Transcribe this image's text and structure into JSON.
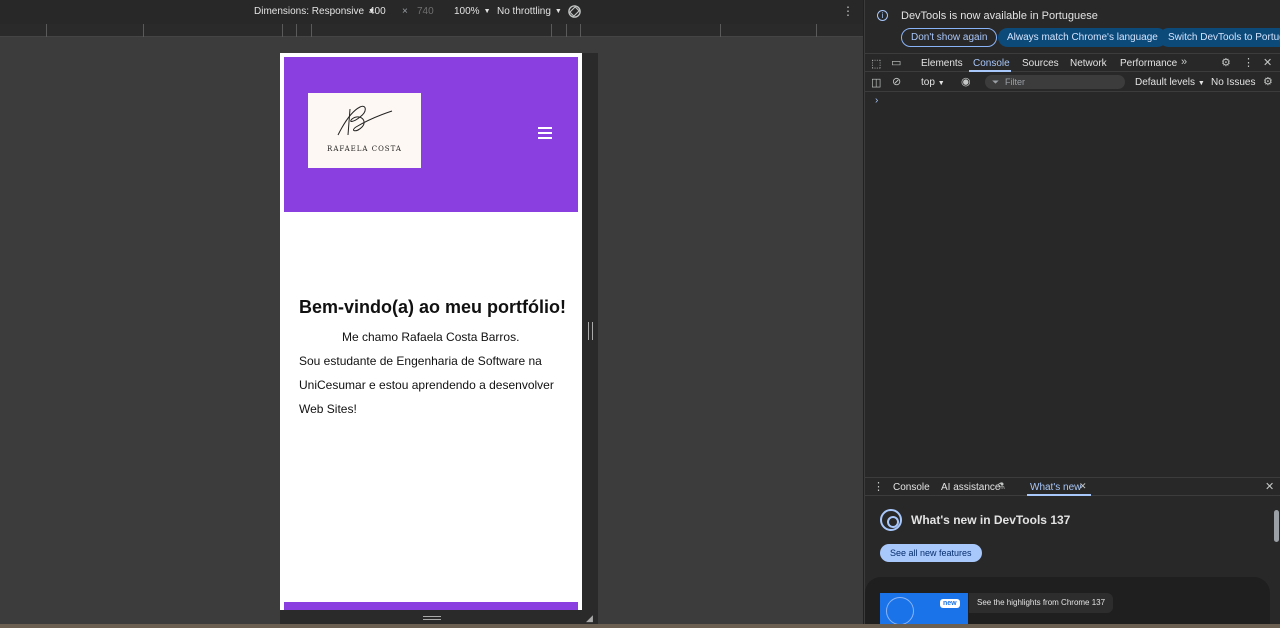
{
  "device_toolbar": {
    "dimensions_label": "Dimensions: Responsive",
    "width": "400",
    "times": "×",
    "height": "740",
    "zoom": "100%",
    "throttling": "No throttling"
  },
  "page": {
    "logo_text": "RAFAELA COSTA",
    "heading": "Bem-vindo(a) ao meu portfólio!",
    "paragraph_line1": "Me chamo Rafaela Costa Barros.",
    "paragraph_rest": "Sou estudante de Engenharia de Software na UniCesumar e estou aprendendo a desenvolver Web Sites!",
    "header_color": "#8a3fe0"
  },
  "devtools": {
    "info_message": "DevTools is now available in Portuguese",
    "btn_dont_show": "Don't show again",
    "btn_match": "Always match Chrome's language",
    "btn_switch": "Switch DevTools to Portuguese",
    "tabs": [
      "Elements",
      "Console",
      "Sources",
      "Network",
      "Performance"
    ],
    "active_tab": "Console",
    "context": "top",
    "filter_placeholder": "Filter",
    "levels": "Default levels",
    "issues": "No Issues",
    "prompt": "›",
    "drawer_tabs": [
      "Console",
      "AI assistance",
      "What's new"
    ],
    "whats_new_title": "What's new in DevTools 137",
    "see_all": "See all new features",
    "card_badge": "new",
    "card_text": "See the highlights from Chrome 137"
  }
}
